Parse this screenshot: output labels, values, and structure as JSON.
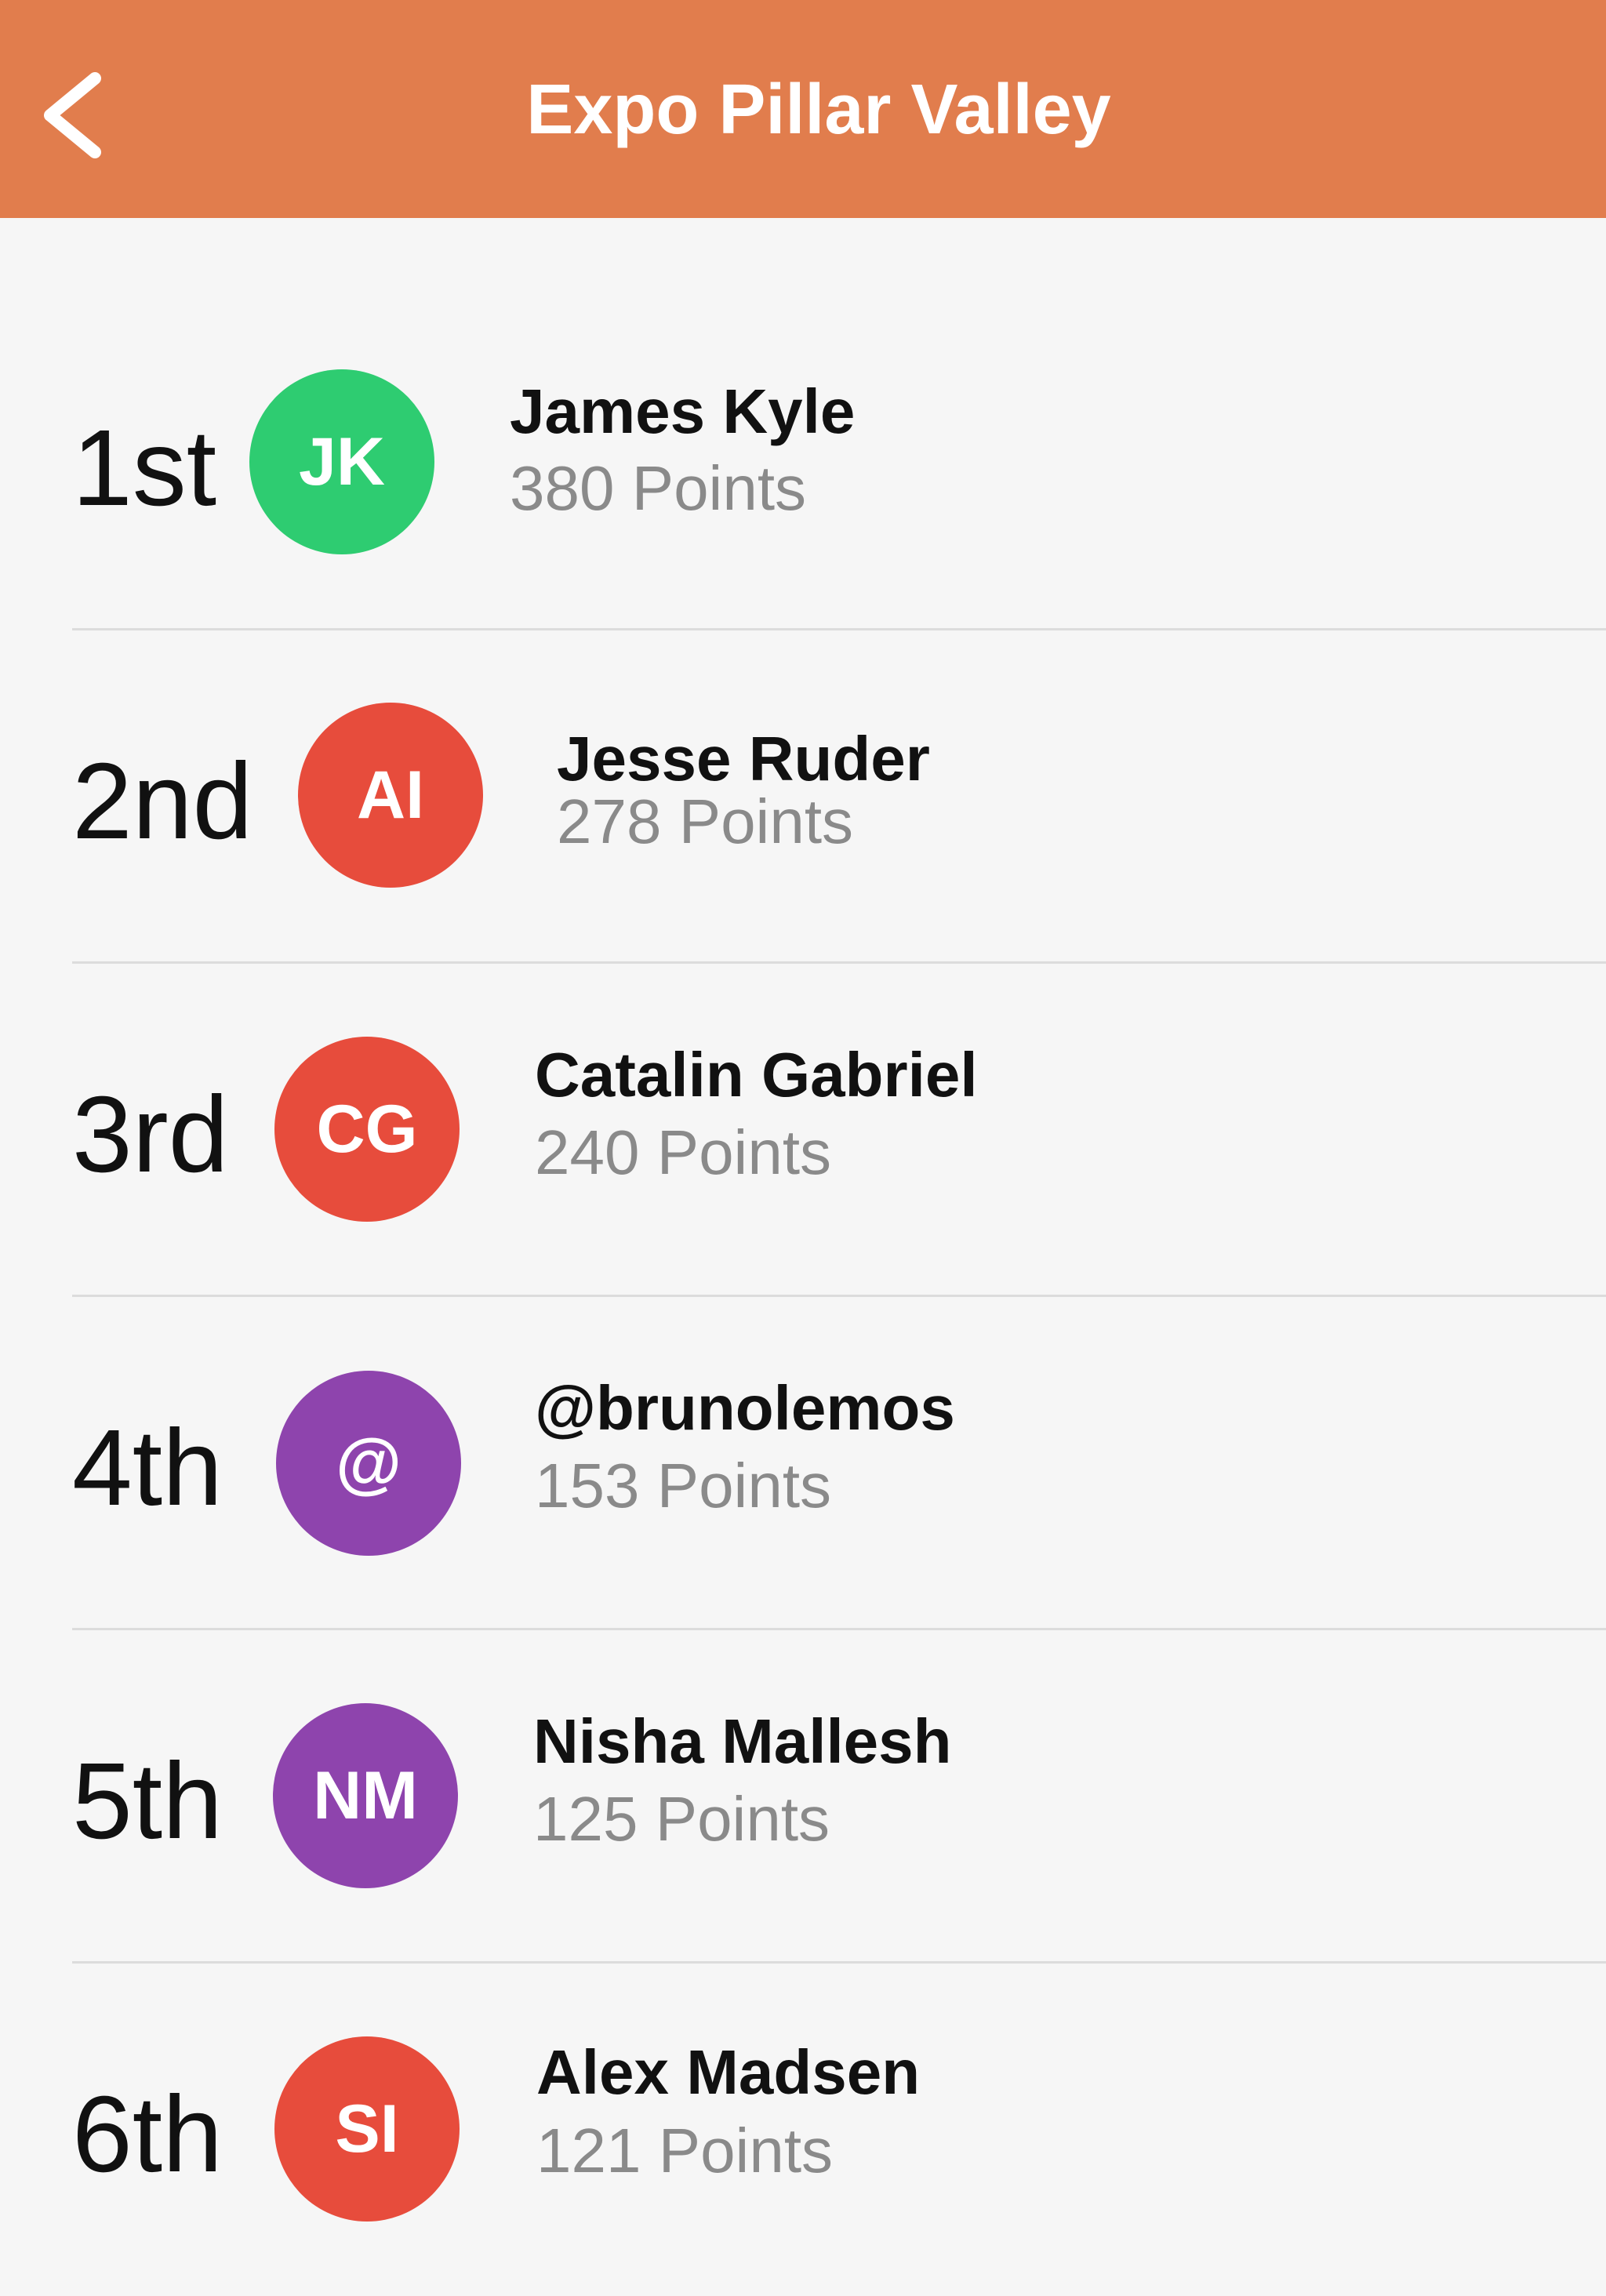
{
  "header": {
    "title": "Expo Pillar Valley",
    "back_icon": "chevron-left-icon",
    "background_color": "#e17d4d"
  },
  "leaderboard": [
    {
      "rank": "1st",
      "initials": "JK",
      "name": "James Kyle",
      "points": "380 Points",
      "avatar_color": "#2ecc71"
    },
    {
      "rank": "2nd",
      "initials": "AI",
      "name": "Jesse Ruder",
      "points": "278 Points",
      "avatar_color": "#e74c3c"
    },
    {
      "rank": "3rd",
      "initials": "CG",
      "name": "Catalin Gabriel",
      "points": "240 Points",
      "avatar_color": "#e74c3c"
    },
    {
      "rank": "4th",
      "initials": "@",
      "name": "@brunolemos",
      "points": "153 Points",
      "avatar_color": "#8e44ad"
    },
    {
      "rank": "5th",
      "initials": "NM",
      "name": "Nisha Mallesh",
      "points": "125 Points",
      "avatar_color": "#8e44ad"
    },
    {
      "rank": "6th",
      "initials": "SI",
      "name": "Alex Madsen",
      "points": "121 Points",
      "avatar_color": "#e74c3c"
    }
  ]
}
